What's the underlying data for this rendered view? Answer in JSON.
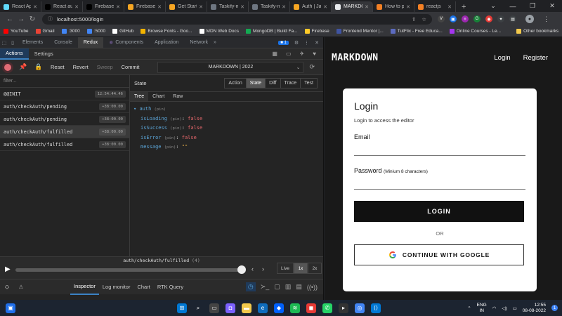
{
  "browser": {
    "tabs": [
      {
        "title": "React App",
        "color": "#61dafb",
        "active": false
      },
      {
        "title": "React auth",
        "color": "#000000",
        "active": false
      },
      {
        "title": "Firebase",
        "color": "#000000",
        "active": false
      },
      {
        "title": "Firebase",
        "color": "#f6a623",
        "active": false
      },
      {
        "title": "Get Started",
        "color": "#f6a623",
        "active": false
      },
      {
        "title": "Taskify-m",
        "color": "#6e7681",
        "active": false
      },
      {
        "title": "Taskify-m",
        "color": "#6e7681",
        "active": false
      },
      {
        "title": "Auth | Ja",
        "color": "#f6a623",
        "active": false
      },
      {
        "title": "MARKDOWN",
        "color": "#e8eaed",
        "active": true
      },
      {
        "title": "How to p",
        "color": "#f48024",
        "active": false
      },
      {
        "title": "reactjs",
        "color": "#f48024",
        "active": false
      }
    ],
    "url": "localhost:5000/login",
    "bookmarks": [
      "YouTube",
      "Gmail",
      ":3000",
      ":5000",
      "GitHub",
      "Browse Fonts - Goo...",
      "MDN Web Docs",
      "MongoDB | Build Fa...",
      "Firebase",
      "Frontend Mentor |...",
      "TutFlix - Free Educa...",
      "Online Courses - Le..."
    ],
    "other_bookmarks": "Other bookmarks"
  },
  "devtools": {
    "tabs": [
      "Elements",
      "Console",
      "Redux",
      "Components",
      "Application",
      "Network"
    ],
    "active_tab": "Redux",
    "issues_count": "1"
  },
  "redux": {
    "top_tabs": [
      "Actions",
      "Settings"
    ],
    "buttons": {
      "reset": "Reset",
      "revert": "Revert",
      "sweep": "Sweep",
      "commit": "Commit"
    },
    "instance": "MARKDOWN | 2022",
    "filter_placeholder": "filter...",
    "actions": [
      {
        "name": "@@INIT",
        "time": "12:54:44.46"
      },
      {
        "name": "auth/checkAuth/pending",
        "time": "+38:00.00"
      },
      {
        "name": "auth/checkAuth/pending",
        "time": "+38:00.00"
      },
      {
        "name": "auth/checkAuth/fulfilled",
        "time": "+38:00.00"
      },
      {
        "name": "auth/checkAuth/fulfilled",
        "time": "+38:00.00"
      }
    ],
    "state_title": "State",
    "monitor_tabs": [
      "Action",
      "State",
      "Diff",
      "Trace",
      "Test"
    ],
    "sub_tabs": [
      "Tree",
      "Chart",
      "Raw"
    ],
    "tree": {
      "root": "auth",
      "pin": "(pin)",
      "fields": [
        {
          "key": "isLoading",
          "value": "false"
        },
        {
          "key": "isSuccess",
          "value": "false"
        },
        {
          "key": "isError",
          "value": "false"
        },
        {
          "key": "message",
          "value": "\"\""
        }
      ]
    },
    "slider": {
      "label": "auth/checkAuth/fulfilled",
      "count": "(4)",
      "progress": 1.0
    },
    "speeds": [
      "Live",
      "1x",
      "2x"
    ],
    "bottom_tabs": [
      "Inspector",
      "Log monitor",
      "Chart",
      "RTK Query"
    ]
  },
  "site": {
    "brand": "MARKDOWN",
    "nav": {
      "login": "Login",
      "register": "Register"
    },
    "card": {
      "title": "Login",
      "subtitle": "Login to access the editor",
      "email_label": "Email",
      "password_label": "Password",
      "password_hint": "(Minium 8 characters)",
      "login_button": "LOGIN",
      "or": "OR",
      "google_button": "CONTINUE WITH GOOGLE"
    }
  },
  "taskbar": {
    "lang_top": "ENG",
    "lang_bottom": "IN",
    "time": "12:55",
    "date": "08-08-2022",
    "notifications": "1"
  }
}
